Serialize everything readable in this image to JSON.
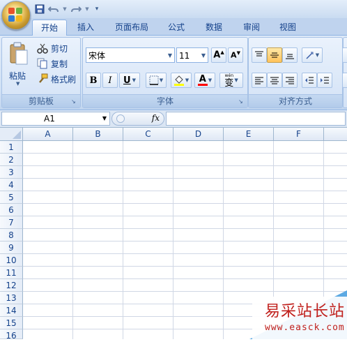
{
  "tabs": [
    {
      "label": "开始",
      "active": true
    },
    {
      "label": "插入"
    },
    {
      "label": "页面布局"
    },
    {
      "label": "公式"
    },
    {
      "label": "数据"
    },
    {
      "label": "审阅"
    },
    {
      "label": "视图"
    }
  ],
  "clipboard": {
    "paste": "粘贴",
    "cut": "剪切",
    "copy": "复制",
    "format_painter": "格式刷",
    "group_label": "剪贴板"
  },
  "font": {
    "family": "宋体",
    "size": "11",
    "bold": "B",
    "italic": "I",
    "underline": "U",
    "font_color_glyph": "A",
    "phonetic_glyph": "wén",
    "phonetic_char": "变",
    "group_label": "字体"
  },
  "alignment": {
    "group_label": "对齐方式"
  },
  "formula_bar": {
    "name_box": "A1",
    "fx": "fx",
    "formula": ""
  },
  "grid": {
    "columns": [
      "A",
      "B",
      "C",
      "D",
      "E",
      "F"
    ],
    "rows": [
      "1",
      "2",
      "3",
      "4",
      "5",
      "6",
      "7",
      "8",
      "9",
      "10",
      "11",
      "12",
      "13",
      "14",
      "15",
      "16"
    ]
  },
  "watermark": {
    "title": "易采站长站",
    "url": "www.easck.com"
  },
  "colors": {
    "accent": "#15428b",
    "highlight": "#ffff00",
    "font_color": "#ff0000",
    "watermark": "#c0201c"
  }
}
